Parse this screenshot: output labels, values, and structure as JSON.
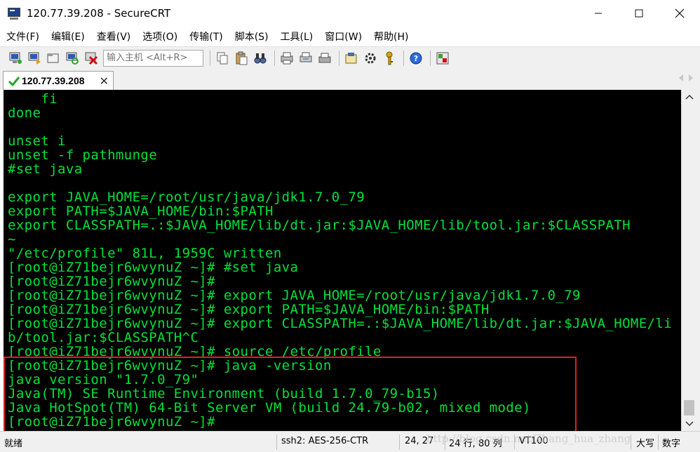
{
  "window": {
    "title": "120.77.39.208 - SecureCRT"
  },
  "menu": {
    "items": [
      "文件(F)",
      "编辑(E)",
      "查看(V)",
      "选项(O)",
      "传输(T)",
      "脚本(S)",
      "工具(L)",
      "窗口(W)",
      "帮助(H)"
    ]
  },
  "toolbar": {
    "host_placeholder": "输入主机 <Alt+R>"
  },
  "tab": {
    "label": "120.77.39.208"
  },
  "terminal": {
    "lines": [
      "    fi",
      "done",
      "",
      "unset i",
      "unset -f pathmunge",
      "#set java",
      "",
      "export JAVA_HOME=/root/usr/java/jdk1.7.0_79",
      "export PATH=$JAVA_HOME/bin:$PATH",
      "export CLASSPATH=.:$JAVA_HOME/lib/dt.jar:$JAVA_HOME/lib/tool.jar:$CLASSPATH",
      "~",
      "\"/etc/profile\" 81L, 1959C written",
      "[root@iZ71bejr6wvynuZ ~]# #set java",
      "[root@iZ71bejr6wvynuZ ~]#",
      "[root@iZ71bejr6wvynuZ ~]# export JAVA_HOME=/root/usr/java/jdk1.7.0_79",
      "[root@iZ71bejr6wvynuZ ~]# export PATH=$JAVA_HOME/bin:$PATH",
      "[root@iZ71bejr6wvynuZ ~]# export CLASSPATH=.:$JAVA_HOME/lib/dt.jar:$JAVA_HOME/li",
      "b/tool.jar:$CLASSPATH^C",
      "[root@iZ71bejr6wvynuZ ~]# source /etc/profile",
      "[root@iZ71bejr6wvynuZ ~]# java -version",
      "java version \"1.7.0_79\"",
      "Java(TM) SE Runtime Environment (build 1.7.0_79-b15)",
      "Java HotSpot(TM) 64-Bit Server VM (build 24.79-b02, mixed mode)",
      "[root@iZ71bejr6wvynuZ ~]#"
    ],
    "text_color": "#00e13a",
    "background": "#000000"
  },
  "highlight": {
    "color": "#e02020"
  },
  "status": {
    "ready": "就绪",
    "encryption": "ssh2: AES-256-CTR",
    "cursor": "24, 27",
    "size": "24 行, 80 列",
    "emulation": "VT100",
    "caps": "大写",
    "numlock": "数字"
  },
  "watermark": "http://blog.csdn.net/Zhang_hua_zhang"
}
